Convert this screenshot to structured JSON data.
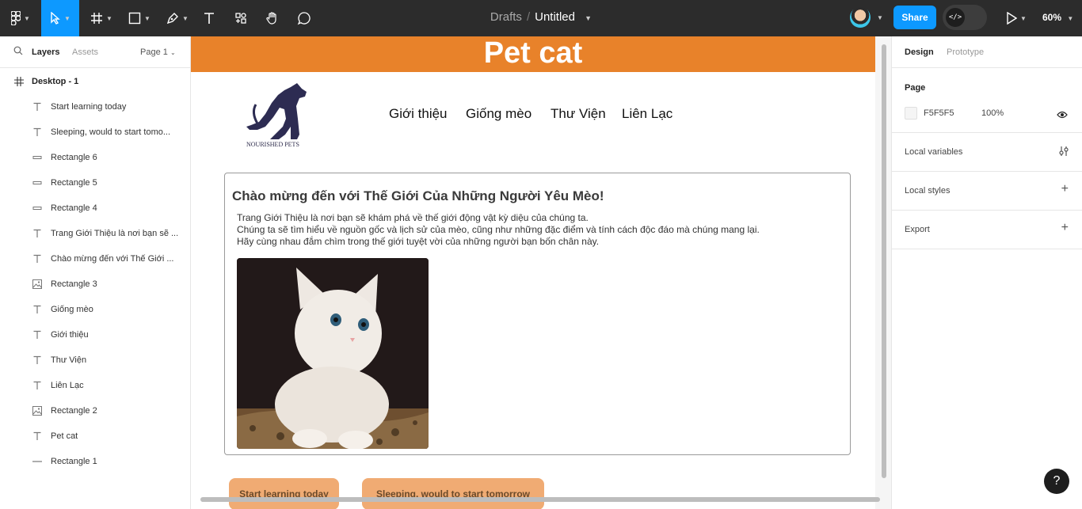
{
  "toolbar": {
    "document": {
      "folder": "Drafts",
      "name": "Untitled"
    },
    "share_label": "Share",
    "zoom": "60%"
  },
  "left_panel": {
    "tabs": {
      "layers": "Layers",
      "assets": "Assets",
      "page": "Page 1"
    },
    "frame": "Desktop - 1",
    "layers": [
      {
        "type": "text",
        "label": "Start learning today"
      },
      {
        "type": "text",
        "label": "Sleeping, would to start tomo..."
      },
      {
        "type": "rect",
        "label": "Rectangle 6"
      },
      {
        "type": "rect",
        "label": "Rectangle 5"
      },
      {
        "type": "rect",
        "label": "Rectangle 4"
      },
      {
        "type": "text",
        "label": "Trang Giới Thiệu là nơi bạn sẽ ..."
      },
      {
        "type": "text",
        "label": "Chào mừng đến với Thế Giới ..."
      },
      {
        "type": "image",
        "label": "Rectangle 3"
      },
      {
        "type": "text",
        "label": "Giống mèo"
      },
      {
        "type": "text",
        "label": "Giới thiệu"
      },
      {
        "type": "text",
        "label": "Thư Viện"
      },
      {
        "type": "text",
        "label": "Liên Lạc"
      },
      {
        "type": "image",
        "label": "Rectangle 2"
      },
      {
        "type": "text",
        "label": "Pet cat"
      },
      {
        "type": "line",
        "label": "Rectangle 1"
      }
    ]
  },
  "canvas": {
    "banner_title": "Pet cat",
    "logo_text": "NOURISHED PETS",
    "nav": [
      "Giới thiệu",
      "Giống mèo",
      "Thư Viện",
      "Liên Lạc"
    ],
    "card": {
      "title": "Chào mừng đến với Thế Giới Của Những Người Yêu Mèo!",
      "lines": [
        "Trang Giới Thiệu là nơi bạn sẽ khám phá về thế giới động vật kỳ diệu của chúng ta.",
        "Chúng ta sẽ tìm hiểu về nguồn gốc và lịch sử của mèo, cũng như những đặc điểm và tính cách độc đáo mà chúng mang lại.",
        "Hãy cùng nhau đắm chìm trong thế giới tuyệt vời của những người bạn bốn chân này."
      ]
    },
    "buttons": {
      "start": "Start learning today",
      "sleep": "Sleeping, would to start tomorrow"
    },
    "colors": {
      "banner": "#e8822a",
      "button": "#f0ab73",
      "accent": "#0d99ff"
    }
  },
  "right_panel": {
    "tabs": {
      "design": "Design",
      "prototype": "Prototype"
    },
    "page": {
      "label": "Page",
      "color": "F5F5F5",
      "opacity": "100%"
    },
    "local_variables": "Local variables",
    "local_styles": "Local styles",
    "export": "Export"
  },
  "help_label": "?"
}
